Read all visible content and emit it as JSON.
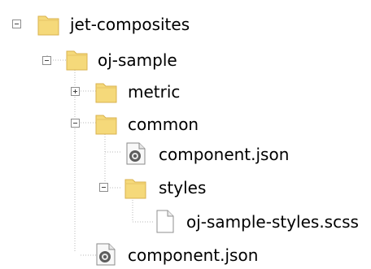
{
  "tree": {
    "items": [
      {
        "label": "jet-composites",
        "icon": "folder-icon",
        "toggle": "collapse"
      },
      {
        "label": "oj-sample",
        "icon": "folder-icon",
        "toggle": "collapse"
      },
      {
        "label": "metric",
        "icon": "folder-icon",
        "toggle": "expand"
      },
      {
        "label": "common",
        "icon": "folder-icon",
        "toggle": "collapse"
      },
      {
        "label": "component.json",
        "icon": "settings-file-icon",
        "toggle": ""
      },
      {
        "label": "styles",
        "icon": "folder-icon",
        "toggle": "collapse"
      },
      {
        "label": "oj-sample-styles.scss",
        "icon": "file-icon",
        "toggle": ""
      },
      {
        "label": "component.json",
        "icon": "settings-file-icon",
        "toggle": ""
      }
    ]
  },
  "colors": {
    "folder": "#f5d97a",
    "folder_edge": "#d9b24f",
    "guide": "#b8b8b8"
  }
}
